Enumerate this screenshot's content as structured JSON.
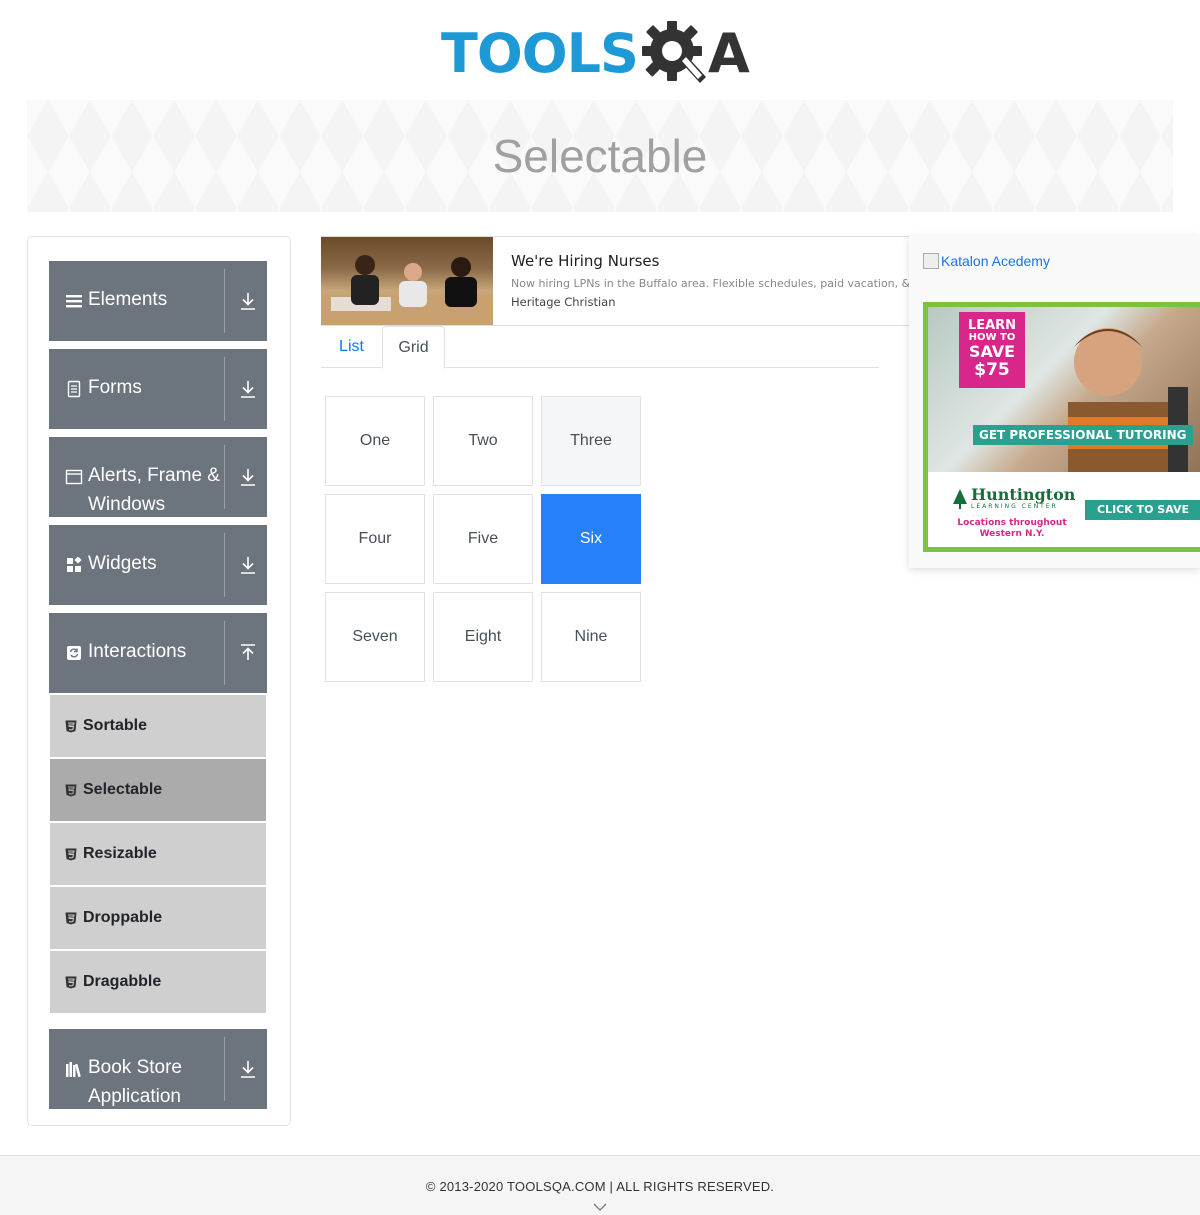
{
  "logo": {
    "tools": "TOOLS",
    "qa_a": "A",
    "brand_color": "#1d9ad6"
  },
  "banner": {
    "title": "Selectable"
  },
  "sidebar": {
    "groups": [
      {
        "label": "Elements",
        "icon": "hamburger-icon",
        "arrow": "download-icon"
      },
      {
        "label": "Forms",
        "icon": "document-icon",
        "arrow": "download-icon"
      },
      {
        "label": "Alerts, Frame & Windows",
        "icon": "window-icon",
        "arrow": "download-icon"
      },
      {
        "label": "Widgets",
        "icon": "widgets-icon",
        "arrow": "download-icon"
      },
      {
        "label": "Interactions",
        "icon": "interactions-icon",
        "arrow": "upload-icon"
      },
      {
        "label": "Book Store Application",
        "icon": "books-icon",
        "arrow": "download-icon"
      }
    ],
    "interaction_items": [
      {
        "label": "Sortable",
        "active": false
      },
      {
        "label": "Selectable",
        "active": true
      },
      {
        "label": "Resizable",
        "active": false
      },
      {
        "label": "Droppable",
        "active": false
      },
      {
        "label": "Dragabble",
        "active": false
      }
    ]
  },
  "ad_top": {
    "title": "We're Hiring Nurses",
    "description": "Now hiring LPNs in the Buffalo area. Flexible schedules, paid vacation, & mo",
    "source": "Heritage Christian"
  },
  "tabs": [
    {
      "label": "List",
      "active": false
    },
    {
      "label": "Grid",
      "active": true
    }
  ],
  "grid": {
    "cells": [
      "One",
      "Two",
      "Three",
      "Four",
      "Five",
      "Six",
      "Seven",
      "Eight",
      "Nine"
    ],
    "selected": "Six",
    "hovered": "Three",
    "active_color": "#2680f8"
  },
  "ad_right": {
    "alt_text": "Katalon Acedemy",
    "promo": {
      "line1": "LEARN",
      "line2": "HOW TO",
      "line3": "SAVE",
      "line4": "$75"
    },
    "tagline": "GET PROFESSIONAL TUTORING",
    "brand": "Huntington",
    "brand_sub": "LEARNING CENTER",
    "location": "Locations throughout Western N.Y.",
    "cta": "CLICK TO SAVE"
  },
  "footer": {
    "copyright": "© 2013-2020 TOOLSQA.COM | ALL RIGHTS RESERVED."
  }
}
